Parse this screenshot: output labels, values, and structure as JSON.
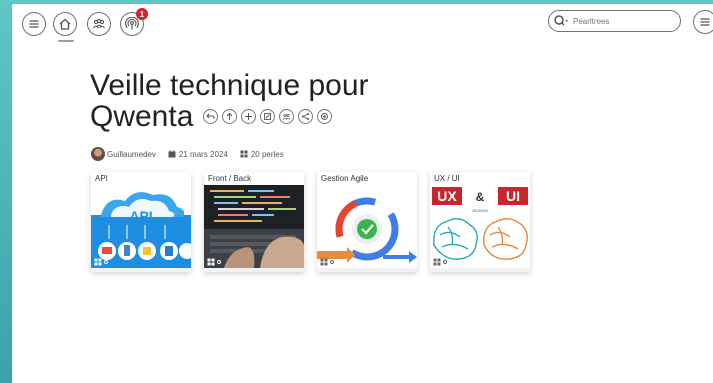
{
  "nav": {
    "notification_count": "1"
  },
  "search": {
    "placeholder": "Pearltrees"
  },
  "collection": {
    "title_line1": "Veille technique pour",
    "title_line2": "Qwenta",
    "author": "Guillaumedev",
    "date": "21 mars 2024",
    "pearl_count": "20 perles"
  },
  "cards": [
    {
      "label": "API",
      "image_text": "API"
    },
    {
      "label": "Front / Back",
      "image_text": ""
    },
    {
      "label": "Gestion Agile",
      "image_text": ""
    },
    {
      "label": "UX / UI",
      "image_text_ux": "UX",
      "image_text_amp": "&",
      "image_text_ui": "UI",
      "image_text_design": "DESIGN"
    }
  ],
  "colors": {
    "frame_teal": "#4fb8b9",
    "notif_red": "#d6232a",
    "api_blue": "#1e8fe0",
    "ux_red": "#c8252c",
    "brain_teal": "#2aa8b4",
    "brain_orange": "#e9863a",
    "agile_blue": "#3f7ee8",
    "agile_green": "#3bb54a",
    "agile_red": "#e5452e"
  }
}
